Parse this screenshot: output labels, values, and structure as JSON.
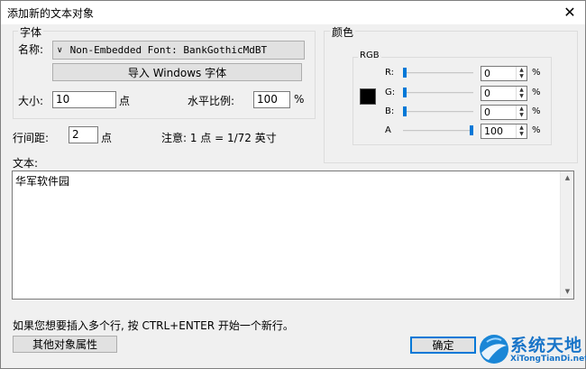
{
  "window": {
    "title": "添加新的文本对象"
  },
  "font_group": {
    "legend": "字体",
    "name_label": "名称:",
    "font_value": "Non-Embedded Font: BankGothicMdBT",
    "import_button": "导入 Windows 字体",
    "size_label": "大小:",
    "size_value": "10",
    "size_unit": "点",
    "hscale_label": "水平比例:",
    "hscale_value": "100",
    "hscale_unit": "%"
  },
  "spacing": {
    "label": "行间距:",
    "value": "2",
    "unit": "点",
    "note": "注意: 1 点 = 1/72 英寸"
  },
  "color_group": {
    "legend": "颜色",
    "rgb_legend": "RGB",
    "swatch_color": "#000000",
    "channels": [
      {
        "label": "R:",
        "value": "0",
        "unit": "%",
        "level": 0
      },
      {
        "label": "G:",
        "value": "0",
        "unit": "%",
        "level": 0
      },
      {
        "label": "B:",
        "value": "0",
        "unit": "%",
        "level": 0
      },
      {
        "label": "A",
        "value": "100",
        "unit": "%",
        "level": 100
      }
    ]
  },
  "text_section": {
    "label": "文本:",
    "content": "华军软件园",
    "hint": "如果您想要插入多个行, 按 CTRL+ENTER 开始一个新行。"
  },
  "buttons": {
    "properties": "其他对象属性",
    "ok": "确定"
  },
  "watermark": {
    "main": "系统天地",
    "sub": "XiTongTianDi.net"
  },
  "icons": {
    "close": "close-icon",
    "dropdown": "chevron-down-icon",
    "spin": "spin-arrows-icon",
    "scroll_up": "arrow-up-icon",
    "scroll_down": "arrow-down-icon"
  }
}
